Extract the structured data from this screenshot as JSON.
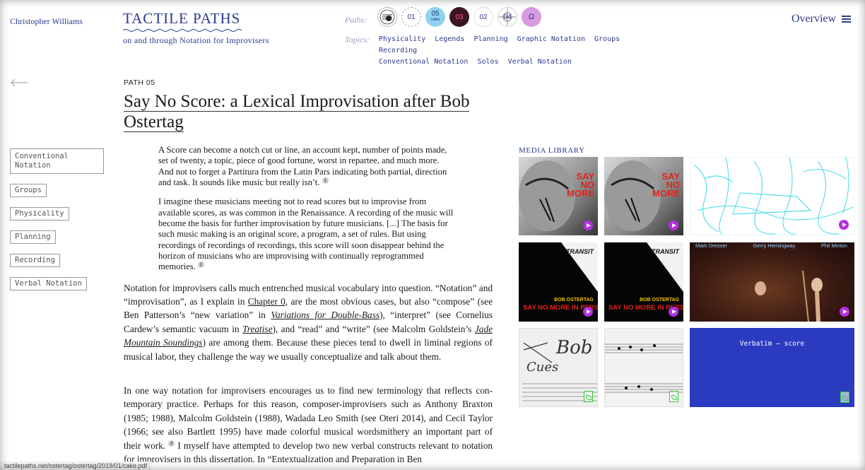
{
  "header": {
    "author": "Christopher Williams",
    "brand_title": "TACTILE PATHS",
    "brand_subtitle": "on and through Notation for Improvisers",
    "paths_label": "Paths:",
    "topics_label": "Topics:",
    "paths": [
      {
        "label": "00",
        "icon": "path-00-icon"
      },
      {
        "label": "01",
        "icon": "path-01-icon"
      },
      {
        "label": "05",
        "sub": "cake",
        "icon": "path-05-icon"
      },
      {
        "label": "03",
        "icon": "path-03-icon"
      },
      {
        "label": "02",
        "icon": "path-02-icon"
      },
      {
        "label": "04",
        "icon": "path-04-icon"
      },
      {
        "label": "Ω",
        "icon": "path-omega-icon"
      }
    ],
    "topics": [
      "Physicality",
      "Legends",
      "Planning",
      "Graphic Notation",
      "Groups",
      "Recording",
      "Conventional Notation",
      "Solos",
      "Verbal Notation"
    ],
    "overview_label": "Overview"
  },
  "sidebar": {
    "tags": [
      "Conventional Notation",
      "Groups",
      "Physicality",
      "Planning",
      "Recording",
      "Verbal Notation"
    ]
  },
  "main": {
    "kicker": "PATH 05",
    "title": "Say No Score: a Lexical Improvisation after Bob Ostertag",
    "quote1": "A Score can become a notch cut or line, an account kept, number of points made, set of twenty, a topic, piece of good fortune, worst in repartee, and much more. And not to forget a Partitura from the Latin Pars indicating both partial, direction and task. It sounds like music but really isn’t.",
    "quote1_fn": "1",
    "quote2": "I imagine these musicians meeting not to read scores but to improvise from available scores, as was common in the Renaissance. A recording of the music will become the basis for further improvisation by future musicians. [...] The basis for such music making is an original score, a program, a set of rules. But using recordings of recordings of recordings, this score will soon disappear behind the horizon of musicians who are improvising with continually repro­grammed memories.",
    "quote2_fn": "2",
    "p1": {
      "a": "Notation for improvisers calls much entrenched musical vocabulary into question. “Notation” and “improvisation”, as I explain in ",
      "link1": "Chapter 0",
      "b": ", are the most obvious cases, but also “compose” (see Ben Patterson’s “new variation” in ",
      "link2": "Variations for Double-Bass",
      "c": "), “interpret” (see Cornelius Cardew’s semantic vacuum in ",
      "link3": "Treatise",
      "d": "), and “read” and “write” (see Malcolm Goldstein’s ",
      "link4": "Jade Mountain Soundings",
      "e": ") are among them. Because these pieces tend to dwell in liminal regions of musical labor, they challenge the way we usually conceptualize and talk about them."
    },
    "p2": {
      "a": "In one way notation for improvisers encourages us to find new terminology that reflects con­temporary practice. Perhaps for this reason, composer-improvisers such as Anthony Braxton (1985; 1988), Malcolm Goldstein (1988), Wadada Leo Smith (see Oteri 2014), and Cecil Taylor (1966; see also Bartlett 1995) have made colorful musical wordsmithery an important part of their work.",
      "fn": "3",
      "b": " I myself have attempted to develop two new verbal constructs relevant to nota­tion for improvisers in this dissertation. In “Entextualization and Preparation in Ben"
    }
  },
  "media": {
    "title": "MEDIA LIBRARY",
    "album1_text": [
      "SAY",
      "NO",
      "MORE"
    ],
    "album2_title": "TRANSIT",
    "album2_artist": "BOB OSTERTAG",
    "album2_text": "SAY NO MORE IN PERSON",
    "video_names": [
      "Mark Dresser",
      "Gerry Hemingway",
      "Phil Minton"
    ],
    "score_handwriting": [
      "Bob",
      "Cues"
    ],
    "verbatim_label": "Verbatim – score",
    "colors": {
      "play": "#b52fe0",
      "pdf": "#2ec832",
      "verbatim_bg": "#2b3bc0"
    }
  },
  "status_url": "tactilepaths.net/ostertag/ostertag/2019/01/cake.pdf"
}
